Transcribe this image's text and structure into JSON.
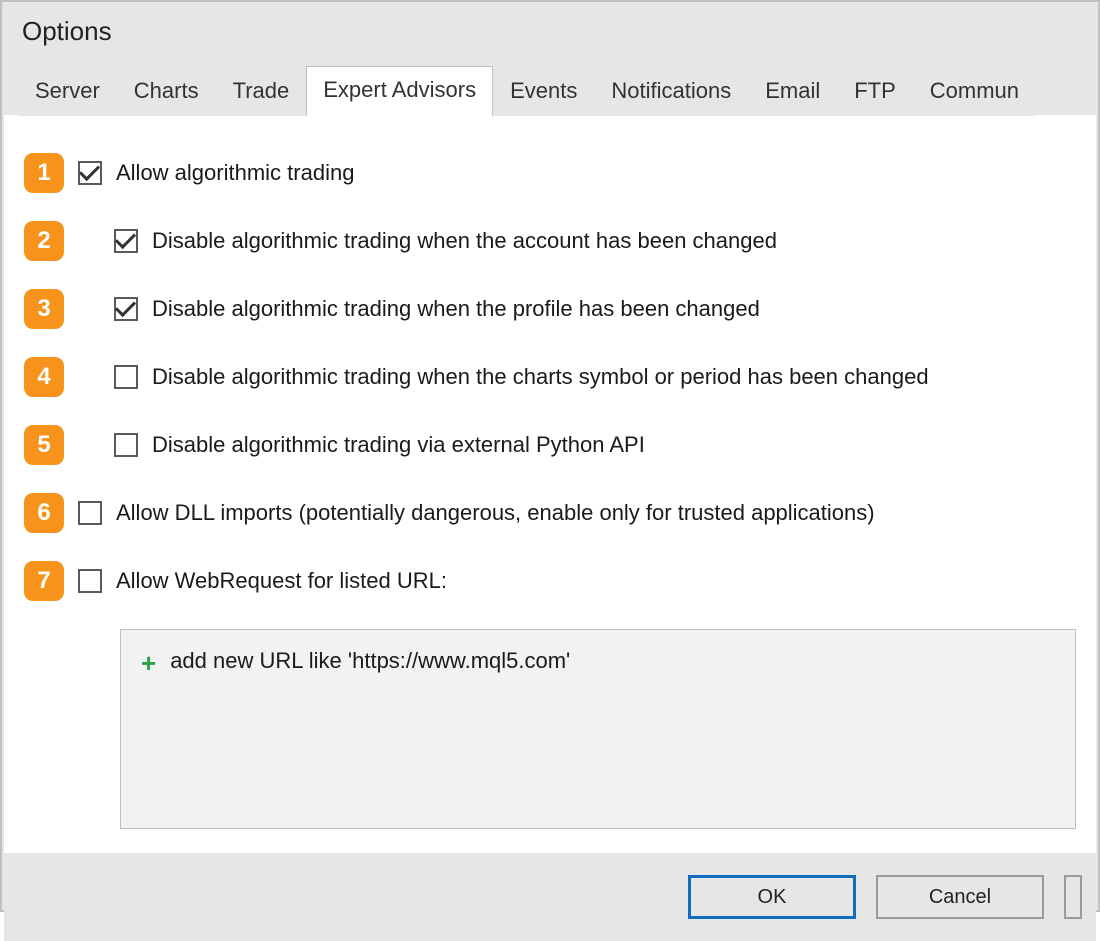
{
  "window": {
    "title": "Options"
  },
  "tabs": [
    {
      "label": "Server"
    },
    {
      "label": "Charts"
    },
    {
      "label": "Trade"
    },
    {
      "label": "Expert Advisors",
      "active": true
    },
    {
      "label": "Events"
    },
    {
      "label": "Notifications"
    },
    {
      "label": "Email"
    },
    {
      "label": "FTP"
    },
    {
      "label": "Commun"
    }
  ],
  "options": [
    {
      "num": "1",
      "indent": 1,
      "checked": true,
      "label": "Allow algorithmic trading"
    },
    {
      "num": "2",
      "indent": 2,
      "checked": true,
      "label": "Disable algorithmic trading when the account has been changed"
    },
    {
      "num": "3",
      "indent": 2,
      "checked": true,
      "label": "Disable algorithmic trading when the profile has been changed"
    },
    {
      "num": "4",
      "indent": 2,
      "checked": false,
      "label": "Disable algorithmic trading when the charts symbol or period has been changed"
    },
    {
      "num": "5",
      "indent": 2,
      "checked": false,
      "label": "Disable algorithmic trading via external Python API"
    },
    {
      "num": "6",
      "indent": 1,
      "checked": false,
      "label": "Allow DLL imports (potentially dangerous, enable only for trusted applications)"
    },
    {
      "num": "7",
      "indent": 1,
      "checked": false,
      "label": "Allow WebRequest for listed URL:"
    }
  ],
  "url_list": {
    "placeholder": "add new URL like 'https://www.mql5.com'"
  },
  "buttons": {
    "ok": "OK",
    "cancel": "Cancel"
  },
  "colors": {
    "marker": "#f7931a",
    "primary_border": "#0f6cbf",
    "plus_icon": "#2ea043"
  }
}
